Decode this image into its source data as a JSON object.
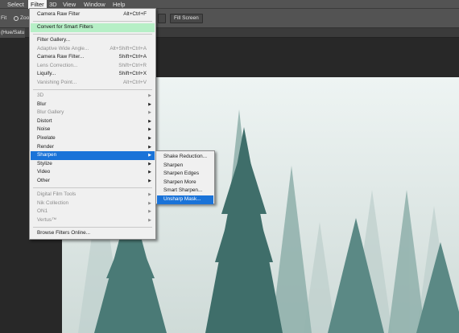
{
  "menubar": {
    "items": [
      {
        "label": "Select"
      },
      {
        "label": "Filter",
        "active": true
      },
      {
        "label": "3D"
      },
      {
        "label": "View"
      },
      {
        "label": "Window"
      },
      {
        "label": "Help"
      }
    ]
  },
  "options": {
    "fit_label": "Fit",
    "zoom_label": "Zoom",
    "fill_screen_label": "Fill Screen"
  },
  "document": {
    "tab_label": "(Hue/Satu"
  },
  "filter_menu": {
    "items": [
      {
        "label": "Camera Raw Filter",
        "shortcut": "Alt+Ctrl+F"
      },
      {
        "label": "Convert for Smart Filters",
        "highlight": "green"
      },
      {
        "label": "Filter Gallery..."
      },
      {
        "label": "Adaptive Wide Angle...",
        "shortcut": "Alt+Shift+Ctrl+A",
        "disabled": true
      },
      {
        "label": "Camera Raw Filter...",
        "shortcut": "Shift+Ctrl+A"
      },
      {
        "label": "Lens Correction...",
        "shortcut": "Shift+Ctrl+R",
        "disabled": true
      },
      {
        "label": "Liquify...",
        "shortcut": "Shift+Ctrl+X"
      },
      {
        "label": "Vanishing Point...",
        "shortcut": "Alt+Ctrl+V",
        "disabled": true
      },
      {
        "label": "3D",
        "submenu": true,
        "disabled": true
      },
      {
        "label": "Blur",
        "submenu": true
      },
      {
        "label": "Blur Gallery",
        "submenu": true,
        "disabled": true
      },
      {
        "label": "Distort",
        "submenu": true
      },
      {
        "label": "Noise",
        "submenu": true
      },
      {
        "label": "Pixelate",
        "submenu": true
      },
      {
        "label": "Render",
        "submenu": true
      },
      {
        "label": "Sharpen",
        "submenu": true,
        "highlight": "blue"
      },
      {
        "label": "Stylize",
        "submenu": true
      },
      {
        "label": "Video",
        "submenu": true
      },
      {
        "label": "Other",
        "submenu": true
      },
      {
        "label": "Digital Film Tools",
        "submenu": true,
        "disabled": true
      },
      {
        "label": "Nik Collection",
        "submenu": true,
        "disabled": true
      },
      {
        "label": "ON1",
        "submenu": true,
        "disabled": true
      },
      {
        "label": "Vertus™",
        "submenu": true,
        "disabled": true
      },
      {
        "label": "Browse Filters Online..."
      }
    ]
  },
  "sharpen_menu": {
    "items": [
      {
        "label": "Shake Reduction..."
      },
      {
        "label": "Sharpen"
      },
      {
        "label": "Sharpen Edges"
      },
      {
        "label": "Sharpen More"
      },
      {
        "label": "Smart Sharpen..."
      },
      {
        "label": "Unsharp Mask...",
        "highlight": "blue"
      }
    ]
  },
  "icons": {
    "submenu_arrow": "submenu-arrow-icon",
    "trees": "forest-image"
  },
  "colors": {
    "menu_highlight_blue": "#1a73d8",
    "menu_highlight_green": "#b6efc6",
    "menu_bg": "#f0f0f0",
    "app_bg": "#282828",
    "chrome": "#535353"
  }
}
